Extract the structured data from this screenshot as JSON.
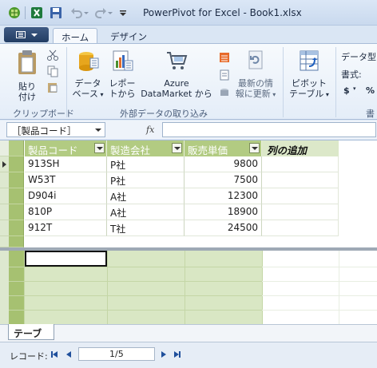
{
  "window": {
    "title": "PowerPivot for Excel - Book1.xlsx"
  },
  "ribbon": {
    "tabs": [
      {
        "label": "ホーム"
      },
      {
        "label": "デザイン"
      }
    ],
    "paste": {
      "line1": "貼り",
      "line2": "付け"
    },
    "clipboard_group": "クリップボード",
    "database": {
      "line1": "データ",
      "line2": "ベース"
    },
    "report": {
      "line1": "レポー",
      "line2": "トから"
    },
    "azure": {
      "line1": "Azure",
      "line2": "DataMarket から"
    },
    "refresh": {
      "line1": "最新の情",
      "line2": "報に更新"
    },
    "external_group": "外部データの取り込み",
    "pivot": {
      "line1": "ピボット",
      "line2": "テーブル"
    },
    "format": {
      "datatype": "データ型:",
      "format_label": "書式:",
      "currency": "$",
      "percent": "%",
      "group_partial": "書"
    }
  },
  "formula_bar": {
    "name_box": "［製品コード］",
    "fx": "fx",
    "formula": ""
  },
  "table": {
    "columns": [
      {
        "label": "製品コード"
      },
      {
        "label": "製造会社"
      },
      {
        "label": "販売単価"
      }
    ],
    "add_column": "列の追加",
    "rows": [
      {
        "code": "913SH",
        "maker": "P社",
        "price": "9800"
      },
      {
        "code": "W53T",
        "maker": "P社",
        "price": "7500"
      },
      {
        "code": "D904i",
        "maker": "A社",
        "price": "12300"
      },
      {
        "code": "810P",
        "maker": "A社",
        "price": "18900"
      },
      {
        "code": "912T",
        "maker": "T社",
        "price": "24500"
      }
    ]
  },
  "sheet_tab": {
    "label": "テーブル"
  },
  "record_nav": {
    "label": "レコード:",
    "position": "1/5"
  }
}
